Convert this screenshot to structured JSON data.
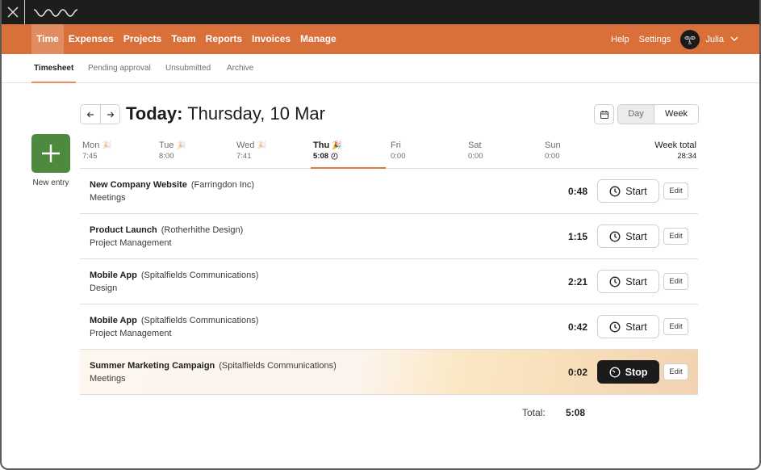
{
  "app": {
    "colors": {
      "brand": "#d9703a",
      "titlebar": "#1d1d1b",
      "new_entry": "#4d8a3e",
      "active_underline": "#e0753d",
      "stop_button": "#1b1b1b"
    }
  },
  "titlebar": {
    "close_icon": "close-icon",
    "logo_icon": "wave-logo-icon"
  },
  "topnav": {
    "items": [
      {
        "label": "Time",
        "active": true
      },
      {
        "label": "Expenses",
        "active": false
      },
      {
        "label": "Projects",
        "active": false
      },
      {
        "label": "Team",
        "active": false
      },
      {
        "label": "Reports",
        "active": false
      },
      {
        "label": "Invoices",
        "active": false
      },
      {
        "label": "Manage",
        "active": false
      }
    ],
    "help_label": "Help",
    "settings_label": "Settings",
    "user_name": "Julia"
  },
  "subtabs": [
    {
      "label": "Timesheet",
      "active": true
    },
    {
      "label": "Pending approval",
      "active": false
    },
    {
      "label": "Unsubmitted",
      "active": false
    },
    {
      "label": "Archive",
      "active": false
    }
  ],
  "header": {
    "title_prefix": "Today:",
    "title_date": "Thursday, 10 Mar",
    "view_options": [
      "Day",
      "Week"
    ],
    "selected_view": "Day"
  },
  "new_entry": {
    "label": "New entry"
  },
  "week": {
    "days": [
      {
        "name": "Mon",
        "hours": "7:45",
        "today": false
      },
      {
        "name": "Tue",
        "hours": "8:00",
        "today": false
      },
      {
        "name": "Wed",
        "hours": "7:41",
        "today": false
      },
      {
        "name": "Thu",
        "hours": "5:08",
        "today": true
      },
      {
        "name": "Fri",
        "hours": "0:00",
        "today": false
      },
      {
        "name": "Sat",
        "hours": "0:00",
        "today": false
      },
      {
        "name": "Sun",
        "hours": "0:00",
        "today": false
      }
    ],
    "total_label": "Week total",
    "total_hours": "28:34"
  },
  "entries": [
    {
      "project": "New Company Website",
      "client": "(Farringdon Inc)",
      "task": "Meetings",
      "duration": "0:48",
      "running": false,
      "action_label": "Start",
      "edit_label": "Edit"
    },
    {
      "project": "Product Launch",
      "client": "(Rotherhithe Design)",
      "task": "Project Management",
      "duration": "1:15",
      "running": false,
      "action_label": "Start",
      "edit_label": "Edit"
    },
    {
      "project": "Mobile App",
      "client": "(Spitalfields Communications)",
      "task": "Design",
      "duration": "2:21",
      "running": false,
      "action_label": "Start",
      "edit_label": "Edit"
    },
    {
      "project": "Mobile App",
      "client": "(Spitalfields Communications)",
      "task": "Project Management",
      "duration": "0:42",
      "running": false,
      "action_label": "Start",
      "edit_label": "Edit"
    },
    {
      "project": "Summer Marketing Campaign",
      "client": "(Spitalfields Communications)",
      "task": "Meetings",
      "duration": "0:02",
      "running": true,
      "action_label": "Stop",
      "edit_label": "Edit"
    }
  ],
  "total": {
    "label": "Total:",
    "value": "5:08"
  }
}
